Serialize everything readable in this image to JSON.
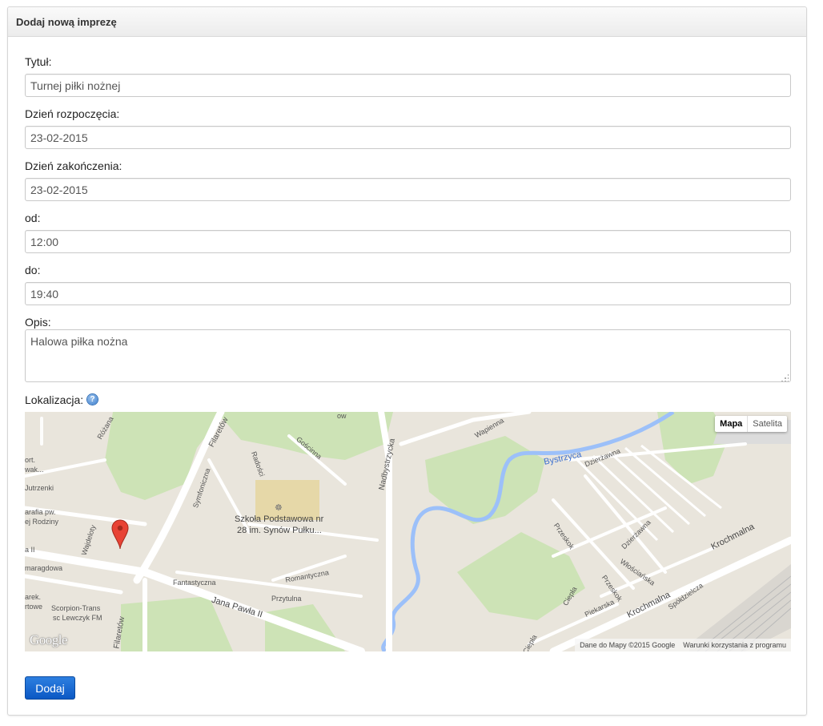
{
  "panel": {
    "title": "Dodaj nową imprezę"
  },
  "form": {
    "title_label": "Tytuł:",
    "title_value": "Turnej piłki nożnej",
    "start_label": "Dzień rozpoczęcia:",
    "start_value": "23-02-2015",
    "end_label": "Dzień zakończenia:",
    "end_value": "23-02-2015",
    "from_label": "od:",
    "from_value": "12:00",
    "to_label": "do:",
    "to_value": "19:40",
    "desc_label": "Opis:",
    "desc_value": "Halowa piłka nożna",
    "location_label": "Lokalizacja:",
    "submit_label": "Dodaj"
  },
  "map": {
    "type_map": "Mapa",
    "type_satellite": "Satelita",
    "attribution": "Dane do Mapy ©2015 Google",
    "terms": "Warunki korzystania z programu",
    "logo": "Google",
    "labels": {
      "school1": "Szkoła Podstawowa nr",
      "school2": "28 im. Synów Pułku...",
      "river": "Bystrzyca",
      "jana": "Jana Pawła II",
      "krochmalna1": "Krochmalna",
      "krochmalna2": "Krochmalna",
      "nadbystrzycka": "Nadbystrzycka",
      "filaretow1": "Filaretów",
      "filaretow2": "Filaretów",
      "fantastyczna": "Fantastyczna",
      "romantyczna": "Romantyczna",
      "przytulna": "Przytulna",
      "goscinna": "Gościnna",
      "radosci": "Radości",
      "symfoniczna": "Symfoniczna",
      "dzierzawna1": "Dzierżawna",
      "dzierzawna2": "Dzierżawna",
      "przeskok1": "Przeskok",
      "przeskok2": "Przeskok",
      "wloscianska": "Włościańska",
      "piekarska": "Piekarska",
      "ciepla1": "Ciepła",
      "ciepla2": "Ciepła",
      "spoldzielcza": "Spółdzielcza",
      "wapienna": "Wapienna",
      "wajdelota": "Wajdeloty",
      "ozana": "Różana",
      "szmaragdowa": "maragdowa",
      "utrzenki": "Jutrzenki",
      "parafia1": "arafia pw.",
      "parafia2": "ej Rodziny",
      "sport1": "ort.",
      "sport2": "wak...",
      "scorpion1": "Scorpion-Trans",
      "scorpion2": "sc Lewczyk FM",
      "arek1": "arek.",
      "arek2": "rtowe",
      "a2": "a II",
      "owa": "ow"
    }
  }
}
